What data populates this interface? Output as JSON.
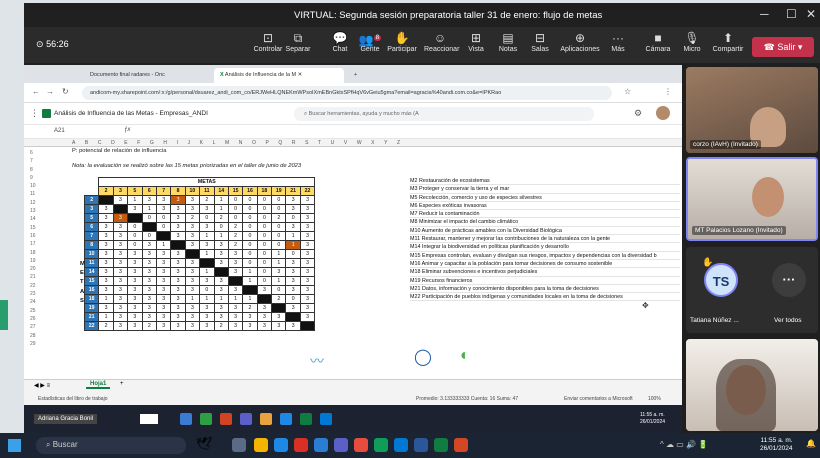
{
  "window": {
    "title": "VIRTUAL: Segunda sesión preparatoria taller 31 de enero: flujo de metas",
    "timer": "56:26"
  },
  "toolbar": {
    "buttons": [
      "Controlar",
      "Separar",
      "Chat",
      "Gente",
      "Participar",
      "Reaccionar",
      "Vista",
      "Notas",
      "Salas",
      "Aplicaciones",
      "Más",
      "Cámara",
      "Micro",
      "Compartir"
    ],
    "people_badge": "8",
    "leave_label": "Salir"
  },
  "browser": {
    "tabs": [
      "Documento final radares - Onc",
      "Análisis de Influencia de la M"
    ],
    "url": "andicom-my.sharepoint.com/:x:/g/personal/dsuarez_andi_com_co/ERJWeHLQNEKmWPsoIXmEBnGktxSPfHqV6vGeiu5gma?email=agracia%40andi.com.co&e=IPKRao"
  },
  "excel": {
    "doc_title": "Análisis de Influencia de las Metas - Empresas_ANDI",
    "search_placeholder": "Buscar herramientas, ayuda y mucho más (A",
    "cell_ref": "A21",
    "col_letters": [
      "A",
      "B",
      "C",
      "D",
      "E",
      "F",
      "G",
      "H",
      "I",
      "J",
      "K",
      "L",
      "M",
      "N",
      "O",
      "P",
      "Q",
      "R",
      "S",
      "T",
      "U",
      "V",
      "W",
      "X",
      "Y",
      "Z"
    ],
    "note_p": "P: potencial de relación de influencia",
    "note_eval": "Nota: la evaluación se realizó sobre las 15 metas priorizadas en el taller de junio de 2023",
    "metas_header": "METAS",
    "meta_numbers": [
      "2",
      "3",
      "5",
      "6",
      "7",
      "8",
      "10",
      "11",
      "14",
      "15",
      "16",
      "18",
      "19",
      "21",
      "22"
    ],
    "row_numbers": [
      "6",
      "7",
      "8",
      "9",
      "10",
      "11",
      "12",
      "13",
      "14",
      "15",
      "16",
      "17",
      "18",
      "19",
      "20",
      "21",
      "22",
      "23",
      "24",
      "25",
      "26",
      "27",
      "28",
      "29"
    ],
    "side_letters": [
      "M",
      "E",
      "T",
      "A",
      "S"
    ],
    "matrix_rows": [
      {
        "label": "2",
        "cells": [
          "X",
          "3",
          "1",
          "3",
          "3",
          "3",
          "3",
          "2",
          "1",
          "0",
          "0",
          "0",
          "0",
          "3",
          "3"
        ]
      },
      {
        "label": "3",
        "cells": [
          "3",
          "X",
          "3",
          "1",
          "3",
          "3",
          "3",
          "3",
          "1",
          "0",
          "0",
          "0",
          "0",
          "3",
          "3"
        ]
      },
      {
        "label": "5",
        "cells": [
          "3",
          "3",
          "X",
          "0",
          "0",
          "3",
          "2",
          "0",
          "2",
          "0",
          "0",
          "0",
          "2",
          "0",
          "3"
        ]
      },
      {
        "label": "6",
        "cells": [
          "3",
          "3",
          "0",
          "X",
          "0",
          "3",
          "3",
          "3",
          "0",
          "2",
          "0",
          "0",
          "0",
          "3",
          "3"
        ]
      },
      {
        "label": "7",
        "cells": [
          "3",
          "3",
          "0",
          "0",
          "X",
          "3",
          "3",
          "1",
          "1",
          "2",
          "0",
          "0",
          "0",
          "1",
          "3"
        ]
      },
      {
        "label": "8",
        "cells": [
          "3",
          "3",
          "0",
          "3",
          "1",
          "X",
          "3",
          "3",
          "3",
          "2",
          "0",
          "0",
          "0",
          "1",
          "3"
        ]
      },
      {
        "label": "10",
        "cells": [
          "3",
          "3",
          "3",
          "3",
          "3",
          "3",
          "X",
          "1",
          "3",
          "3",
          "0",
          "0",
          "1",
          "0",
          "3"
        ]
      },
      {
        "label": "11",
        "cells": [
          "3",
          "3",
          "3",
          "3",
          "3",
          "3",
          "3",
          "X",
          "3",
          "3",
          "0",
          "0",
          "1",
          "3",
          "3"
        ]
      },
      {
        "label": "14",
        "cells": [
          "3",
          "3",
          "3",
          "3",
          "3",
          "3",
          "3",
          "1",
          "X",
          "3",
          "1",
          "0",
          "3",
          "3",
          "3"
        ]
      },
      {
        "label": "15",
        "cells": [
          "3",
          "3",
          "3",
          "3",
          "3",
          "3",
          "3",
          "3",
          "3",
          "X",
          "1",
          "0",
          "1",
          "3",
          "3"
        ]
      },
      {
        "label": "16",
        "cells": [
          "3",
          "3",
          "3",
          "3",
          "3",
          "3",
          "3",
          "0",
          "3",
          "3",
          "X",
          "3",
          "0",
          "3",
          "3"
        ]
      },
      {
        "label": "18",
        "cells": [
          "1",
          "3",
          "3",
          "3",
          "3",
          "3",
          "1",
          "1",
          "1",
          "1",
          "1",
          "X",
          "2",
          "0",
          "3"
        ]
      },
      {
        "label": "19",
        "cells": [
          "3",
          "3",
          "3",
          "3",
          "3",
          "3",
          "3",
          "3",
          "3",
          "3",
          "2",
          "3",
          "X",
          "3",
          "3"
        ]
      },
      {
        "label": "21",
        "cells": [
          "1",
          "3",
          "3",
          "3",
          "3",
          "3",
          "3",
          "3",
          "3",
          "3",
          "3",
          "3",
          "3",
          "X",
          "3"
        ]
      },
      {
        "label": "22",
        "cells": [
          "2",
          "3",
          "3",
          "2",
          "3",
          "3",
          "3",
          "3",
          "2",
          "3",
          "3",
          "3",
          "3",
          "3",
          "X"
        ]
      }
    ],
    "goals": [
      "M2 Restauración de ecosistemas",
      "M3 Proteger y conservar la tierra y el mar",
      "M5 Recolección, comercio y uso de especies silvestres",
      "M6 Especies exóticas invasoras",
      "M7 Reducir la contaminación",
      "M8 Minimizar el impacto del cambio climático",
      "M10 Aumento de prácticas amables con la Diversidad Biológica",
      "M11 Restaurar, mantener y mejorar las contribuciones de la naturaleza con la gente",
      "M14 Integrar la biodiversidad en políticas planificación y desarrollo",
      "M15 Empresas controlan, evaluan y divulgan sus riesgos, impactos y dependencias con la diversidad b",
      "M16 Animar y capacitar a la población para tomar decisiones de consumo sostenible",
      "M18 Eliminar subvenciones e incentivos perjudiciales",
      "M19 Recursos financieros",
      "M21 Datos, información y conocimiento disponibles para la toma de decisiones",
      "M22 Participación de pueblos indígenas y comunidades locales en la toma de decisiones"
    ],
    "sheet_tab": "Hoja1",
    "status_left": "Estadísticas del libro de trabajo",
    "status_mid": "Promedio: 3.133333333   Cuenta: 16   Suma: 47",
    "status_right": "Enviar comentarios a Microsoft",
    "zoom": "100%"
  },
  "participants": [
    {
      "name": "corzo (IAvH) (Invitado)"
    },
    {
      "name": "MT Palacios Lozano (Invitado)"
    },
    {
      "name": "Tatiana Núñez ...",
      "initials": "TS",
      "reaction": "✋"
    },
    {
      "name": "Ver todos"
    }
  ],
  "presenter_label": "Adriana Gracia Bonil",
  "inner_clock": {
    "time": "11:55 a. m.",
    "date": "26/01/2024"
  },
  "taskbar": {
    "search_placeholder": "Buscar",
    "time": "11:55 a. m.",
    "date": "26/01/2024"
  },
  "colors": {
    "accent_blue": "#2e75b6",
    "header_yellow": "#ffd966",
    "orange": "#c55a11",
    "leave_red": "#c4314b"
  }
}
